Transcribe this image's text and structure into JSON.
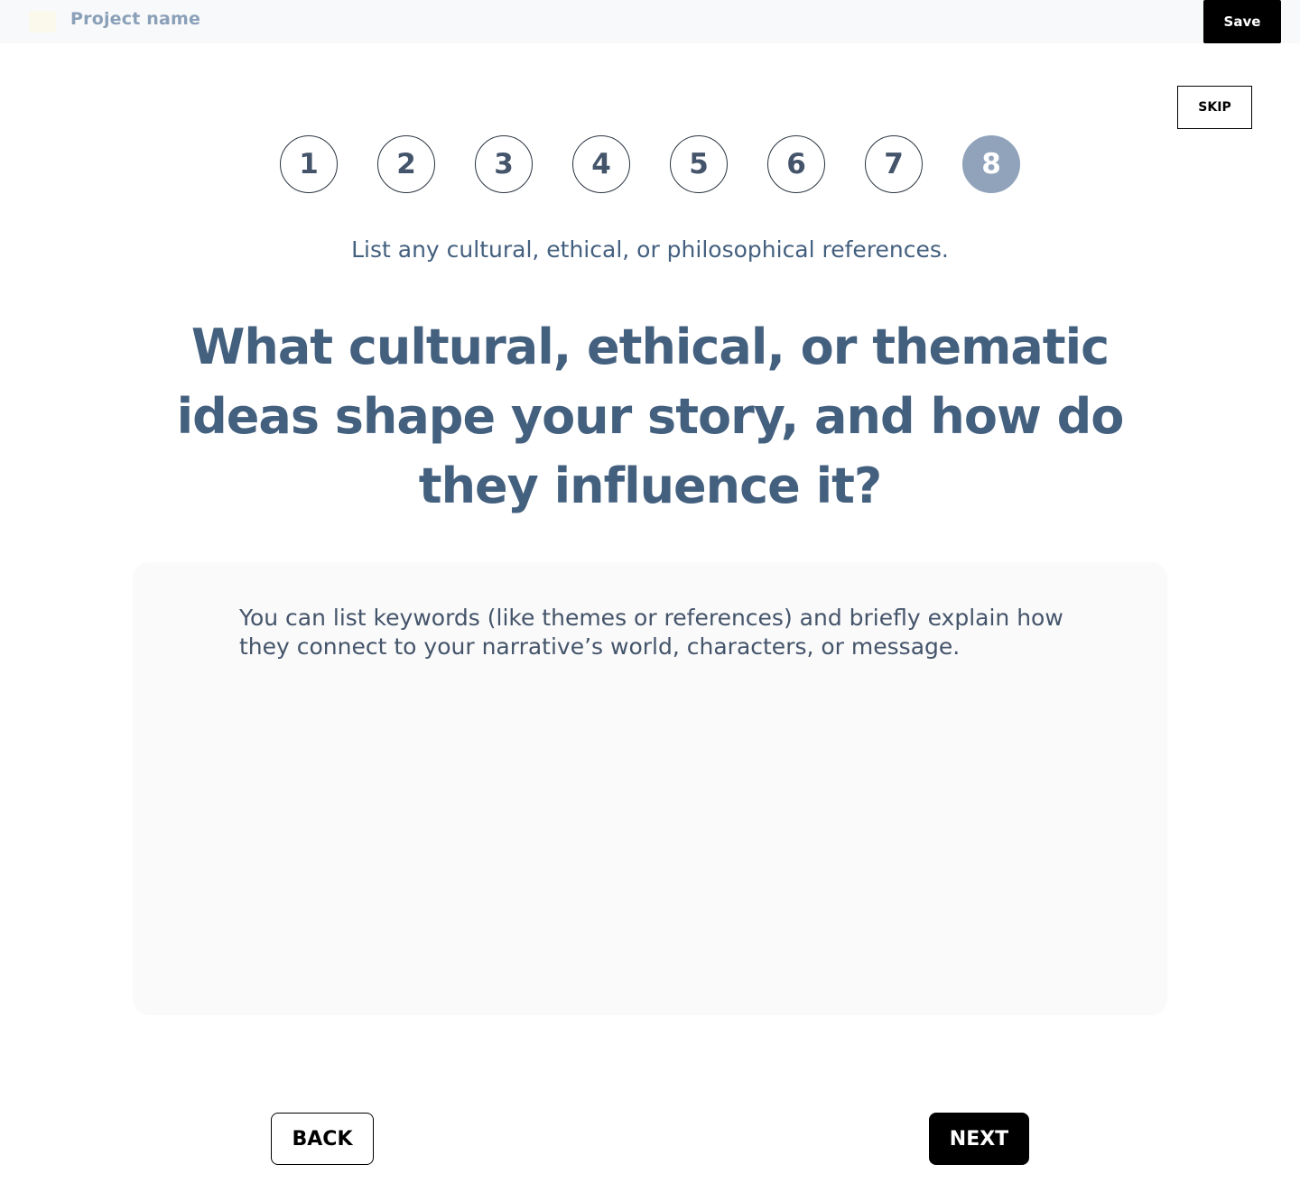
{
  "header": {
    "project_name": "Project name",
    "save_label": "Save"
  },
  "skip_label": "SKIP",
  "steps": [
    {
      "label": "1",
      "active": false
    },
    {
      "label": "2",
      "active": false
    },
    {
      "label": "3",
      "active": false
    },
    {
      "label": "4",
      "active": false
    },
    {
      "label": "5",
      "active": false
    },
    {
      "label": "6",
      "active": false
    },
    {
      "label": "7",
      "active": false
    },
    {
      "label": "8",
      "active": true
    }
  ],
  "subtitle": "List any cultural, ethical, or philosophical references.",
  "question": "What cultural, ethical, or thematic ideas shape your story, and how do they influence it?",
  "answer": {
    "value": "",
    "placeholder": "You can list keywords (like themes or references) and briefly explain how they connect to your narrative’s world, characters, or message."
  },
  "nav": {
    "back_label": "BACK",
    "next_label": "NEXT"
  },
  "colors": {
    "primary_text": "#44607f",
    "active_step": "#91a3bb",
    "button_dark": "#000000"
  }
}
